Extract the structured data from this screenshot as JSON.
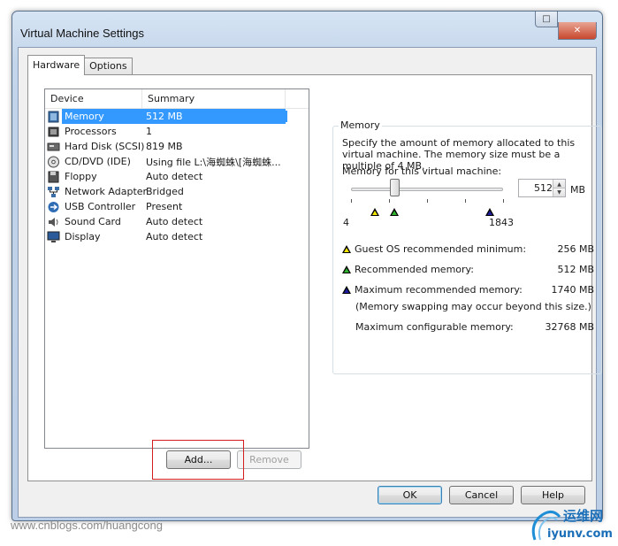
{
  "window": {
    "title": "Virtual Machine Settings",
    "close_label": "✕",
    "min_label": "□"
  },
  "tabs": [
    {
      "label": "Hardware"
    },
    {
      "label": "Options"
    }
  ],
  "device_list": {
    "headers": {
      "device": "Device",
      "summary": "Summary"
    },
    "rows": [
      {
        "device": "Memory",
        "summary": "512 MB",
        "icon": "memory-icon",
        "selected": true
      },
      {
        "device": "Processors",
        "summary": "1",
        "icon": "processor-icon"
      },
      {
        "device": "Hard Disk (SCSI)",
        "summary": "819 MB",
        "icon": "hard-disk-icon"
      },
      {
        "device": "CD/DVD (IDE)",
        "summary": "Using file L:\\海蜘蛛\\[海蜘蛛...",
        "icon": "cd-dvd-icon"
      },
      {
        "device": "Floppy",
        "summary": "Auto detect",
        "icon": "floppy-icon"
      },
      {
        "device": "Network Adapter",
        "summary": "Bridged",
        "icon": "network-adapter-icon"
      },
      {
        "device": "USB Controller",
        "summary": "Present",
        "icon": "usb-icon"
      },
      {
        "device": "Sound Card",
        "summary": "Auto detect",
        "icon": "sound-card-icon"
      },
      {
        "device": "Display",
        "summary": "Auto detect",
        "icon": "display-icon"
      }
    ]
  },
  "buttons": {
    "add": "Add...",
    "remove": "Remove",
    "ok": "OK",
    "cancel": "Cancel",
    "help": "Help"
  },
  "memory": {
    "group_title": "Memory",
    "description": "Specify the amount of memory allocated to this virtual machine. The memory size must be a multiple of 4 MB.",
    "slider_label": "Memory for this virtual machine:",
    "value": "512",
    "unit": "MB",
    "slider_min": "4",
    "slider_max": "1843",
    "slider_value_mb": 512,
    "guest_min_label": "Guest OS recommended minimum:",
    "guest_min_value": "256 MB",
    "recommended_label": "Recommended memory:",
    "recommended_value": "512 MB",
    "max_recommended_label": "Maximum recommended memory:",
    "max_recommended_value": "1740 MB",
    "swap_note": "(Memory swapping may occur beyond this size.)",
    "max_configurable_label": "Maximum configurable memory:",
    "max_configurable_value": "32768 MB",
    "colors": {
      "guest_min": "#f2e600",
      "recommended": "#2db52d",
      "max_recommended": "#1c1c9c"
    }
  },
  "watermark": "www.cnblogs.com/huangcong",
  "logo_text": "运维网",
  "logo_subtext": "iyunv.com"
}
